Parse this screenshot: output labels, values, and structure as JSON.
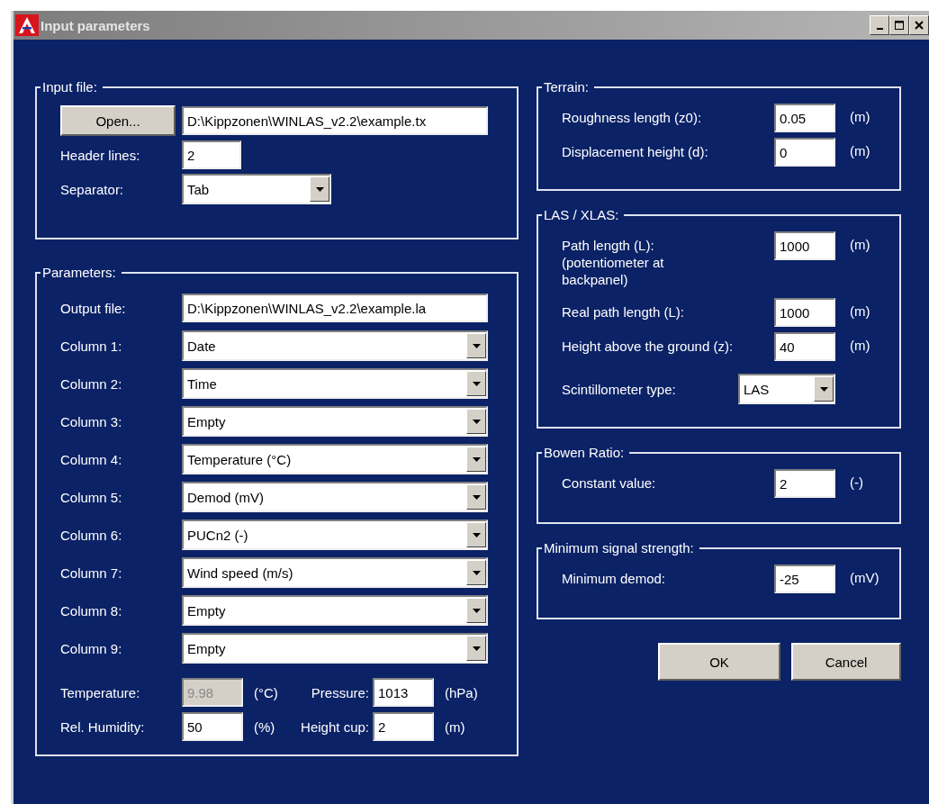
{
  "window": {
    "title": "Input parameters"
  },
  "input_file": {
    "title": "Input file:",
    "open_button": "Open...",
    "path": "D:\\Kippzonen\\WINLAS_v2.2\\example.tx",
    "header_lines_label": "Header lines:",
    "header_lines": "2",
    "separator_label": "Separator:",
    "separator": "Tab"
  },
  "parameters": {
    "title": "Parameters:",
    "output_file_label": "Output file:",
    "output_file": "D:\\Kippzonen\\WINLAS_v2.2\\example.la",
    "columns": [
      {
        "label": "Column 1:",
        "value": "Date"
      },
      {
        "label": "Column 2:",
        "value": "Time"
      },
      {
        "label": "Column 3:",
        "value": "Empty"
      },
      {
        "label": "Column 4:",
        "value": "Temperature (°C)"
      },
      {
        "label": "Column 5:",
        "value": "Demod (mV)"
      },
      {
        "label": "Column 6:",
        "value": "PUCn2 (-)"
      },
      {
        "label": "Column 7:",
        "value": "Wind speed (m/s)"
      },
      {
        "label": "Column 8:",
        "value": "Empty"
      },
      {
        "label": "Column 9:",
        "value": "Empty"
      }
    ],
    "meteo": [
      {
        "label": "Temperature:",
        "value": "9.98",
        "unit": "(°C)",
        "disabled": true
      },
      {
        "label": "Pressure:",
        "value": "1013",
        "unit": "(hPa)",
        "disabled": false
      },
      {
        "label": "Rel. Humidity:",
        "value": "50",
        "unit": "(%)",
        "disabled": false
      },
      {
        "label": "Height cup:",
        "value": "2",
        "unit": "(m)",
        "disabled": false
      }
    ]
  },
  "terrain": {
    "title": "Terrain:",
    "rows": [
      {
        "label": "Roughness length (z0):",
        "value": "0.05",
        "unit": "(m)"
      },
      {
        "label": "Displacement height (d):",
        "value": "0",
        "unit": "(m)"
      }
    ]
  },
  "las": {
    "title": "LAS / XLAS:",
    "rows": [
      {
        "label": "Path length (L):\n(potentiometer at\nbackpanel)",
        "value": "1000",
        "unit": "(m)"
      },
      {
        "label": "Real path length (L):",
        "value": "1000",
        "unit": "(m)"
      },
      {
        "label": "Height above the ground (z):",
        "value": "40",
        "unit": "(m)"
      }
    ],
    "type_label": "Scintillometer type:",
    "type_value": "LAS"
  },
  "bowen": {
    "title": "Bowen Ratio:",
    "rows": [
      {
        "label": "Constant value:",
        "value": "2",
        "unit": "(-)"
      }
    ]
  },
  "signal": {
    "title": "Minimum signal strength:",
    "rows": [
      {
        "label": "Minimum demod:",
        "value": "-25",
        "unit": "(mV)"
      }
    ]
  },
  "buttons": [
    "OK",
    "Cancel"
  ]
}
